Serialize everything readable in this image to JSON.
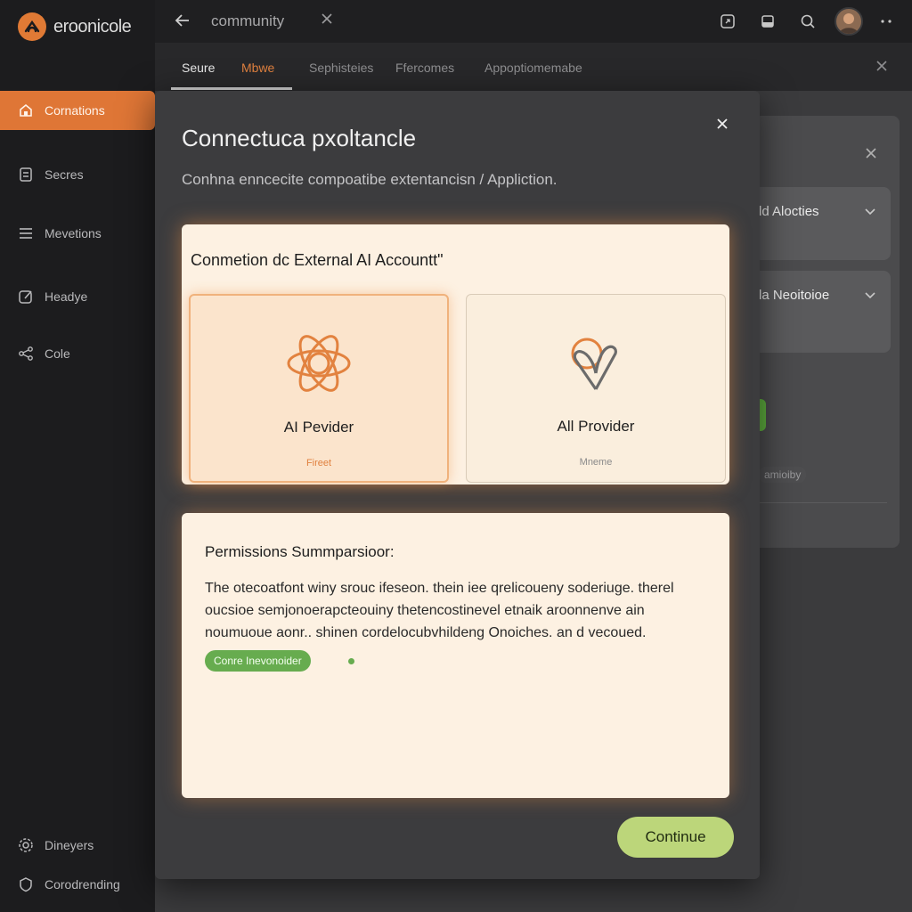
{
  "brand": {
    "name": "eroonicole"
  },
  "sidebar": {
    "items": [
      {
        "label": "Cornations",
        "icon": "home-icon",
        "active": true
      },
      {
        "label": "Secres",
        "icon": "document-icon",
        "active": false
      },
      {
        "label": "Mevetions",
        "icon": "list-icon",
        "active": false
      },
      {
        "label": "Headye",
        "icon": "edit-icon",
        "active": false
      },
      {
        "label": "Cole",
        "icon": "share-icon",
        "active": false
      }
    ],
    "footer": [
      {
        "label": "Dineyers",
        "icon": "settings-icon"
      },
      {
        "label": "Corodrending",
        "icon": "shield-icon"
      }
    ]
  },
  "topbar": {
    "title": "community",
    "back_icon": "back-arrow-icon",
    "close_icon": "close-icon",
    "right_icons": [
      "share-square-icon",
      "window-icon",
      "search-icon",
      "more-icon"
    ]
  },
  "tabs": [
    {
      "label": "Seure",
      "state": "active"
    },
    {
      "label": "Mbwe",
      "state": "accent"
    },
    {
      "label": "Sephisteies",
      "state": "normal"
    },
    {
      "label": "Ffercomes",
      "state": "normal"
    },
    {
      "label": "Appoptiomemabe",
      "state": "normal"
    }
  ],
  "right_panel": {
    "cards": [
      {
        "label": "ld Alocties"
      },
      {
        "label": "la Neoitoioe"
      }
    ],
    "pill_label": "amioiby"
  },
  "modal": {
    "title": "Connectuca pxoltancle",
    "subtitle": "Conhna enncecite compoatibe extentancisn / Appliction.",
    "connection": {
      "title": "Conmetion dc External AI Accountt\"",
      "providers": [
        {
          "name": "AI Pevider",
          "note": "Fireet",
          "selected": true,
          "icon": "atom-icon"
        },
        {
          "name": "All Provider",
          "note": "Mneme",
          "selected": false,
          "icon": "heart-leaf-icon"
        }
      ]
    },
    "permissions": {
      "title": "Permissions Summparsioor:",
      "body": "The otecoatfont winy srouc ifeseon. thein iee qrelicoueny soderiuge. therel oucsioe semjonoerapcteouiny thetencostinevel etnaik aroonnenve ain noumuoue aonr.. shinen cordelocubvhildeng Onoiches. an d vecoued.",
      "badge": "Conre Inevonoider"
    },
    "continue_label": "Continue"
  },
  "colors": {
    "accent_orange": "#df7636",
    "continue_green": "#bcd67a",
    "badge_green": "#67ac4f",
    "card_cream": "#fdf1e2"
  }
}
